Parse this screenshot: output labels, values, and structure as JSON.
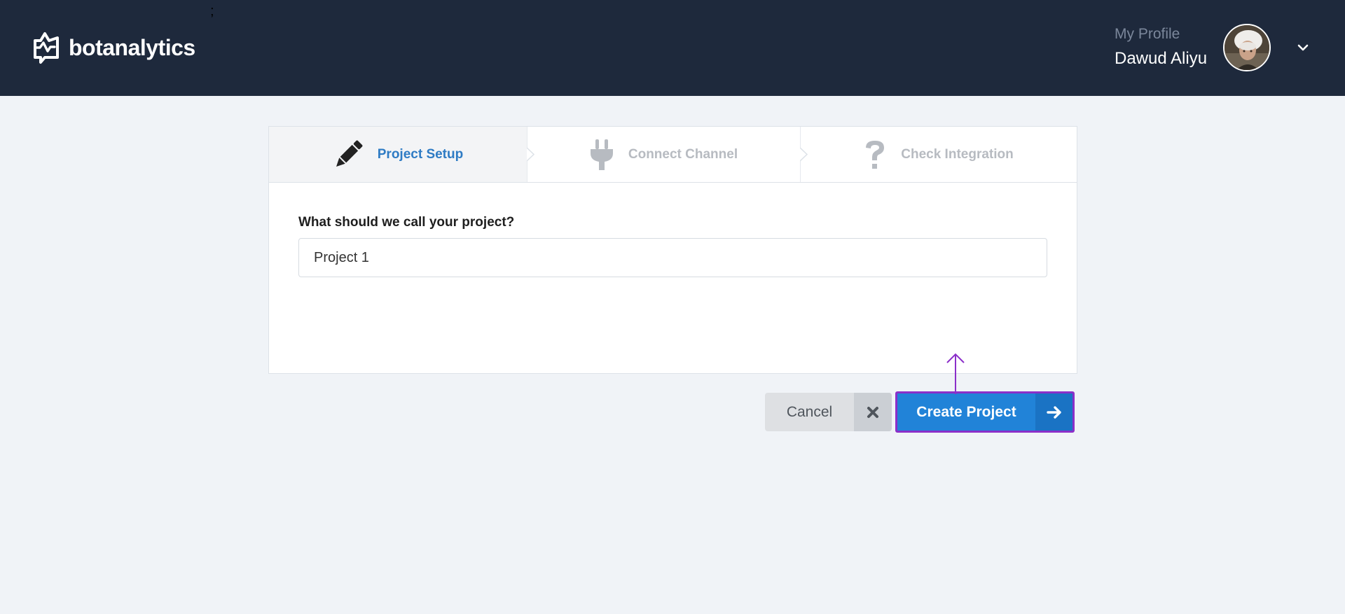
{
  "header": {
    "stray_mark": ";",
    "brand_name": "botanalytics",
    "profile_caption": "My Profile",
    "profile_name": "Dawud Aliyu",
    "background_color": "#1e293c"
  },
  "wizard": {
    "steps": [
      {
        "label": "Project Setup",
        "icon": "pencil-icon",
        "state": "active",
        "color": "#2e7bc4"
      },
      {
        "label": "Connect Channel",
        "icon": "plug-icon",
        "state": "inactive",
        "color": "#b7bbc1"
      },
      {
        "label": "Check Integration",
        "icon": "question-icon",
        "state": "inactive",
        "color": "#b7bbc1"
      }
    ],
    "form": {
      "project_name_label": "What should we call your project?",
      "project_name_value": "Project 1"
    },
    "actions": {
      "cancel_label": "Cancel",
      "cancel_icon": "close-icon",
      "create_label": "Create Project",
      "create_icon": "arrow-right-icon",
      "create_color": "#2183d8",
      "highlight_color": "#8b2fc9"
    }
  },
  "annotation": {
    "pointer": "arrow-up-icon"
  }
}
